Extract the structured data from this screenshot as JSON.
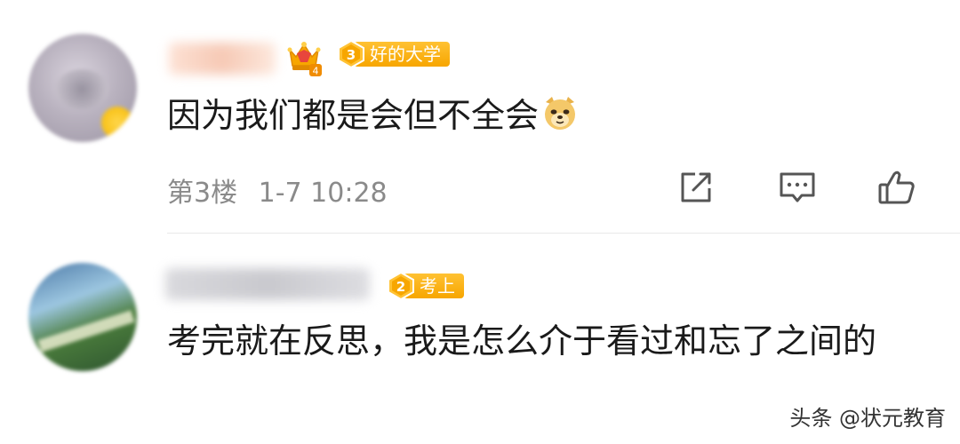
{
  "comments": [
    {
      "username": "",
      "vip_level": "4",
      "badge": {
        "level": "3",
        "text": "好的大学"
      },
      "text": "因为我们都是会但不全会",
      "emoji": "doge-emoji",
      "floor": "第3楼",
      "time": "1-7 10:28",
      "actions": [
        "share-icon",
        "reply-icon",
        "like-icon"
      ]
    },
    {
      "username": "",
      "badge": {
        "level": "2",
        "text": "考上"
      },
      "text": "考完就在反思，我是怎么介于看过和忘了之间的"
    }
  ],
  "watermark": "头条 @状元教育",
  "colors": {
    "badge": "#f7a600",
    "text": "#1a1a1a",
    "meta": "#8a8a8a",
    "divider": "#e9e9e9"
  }
}
